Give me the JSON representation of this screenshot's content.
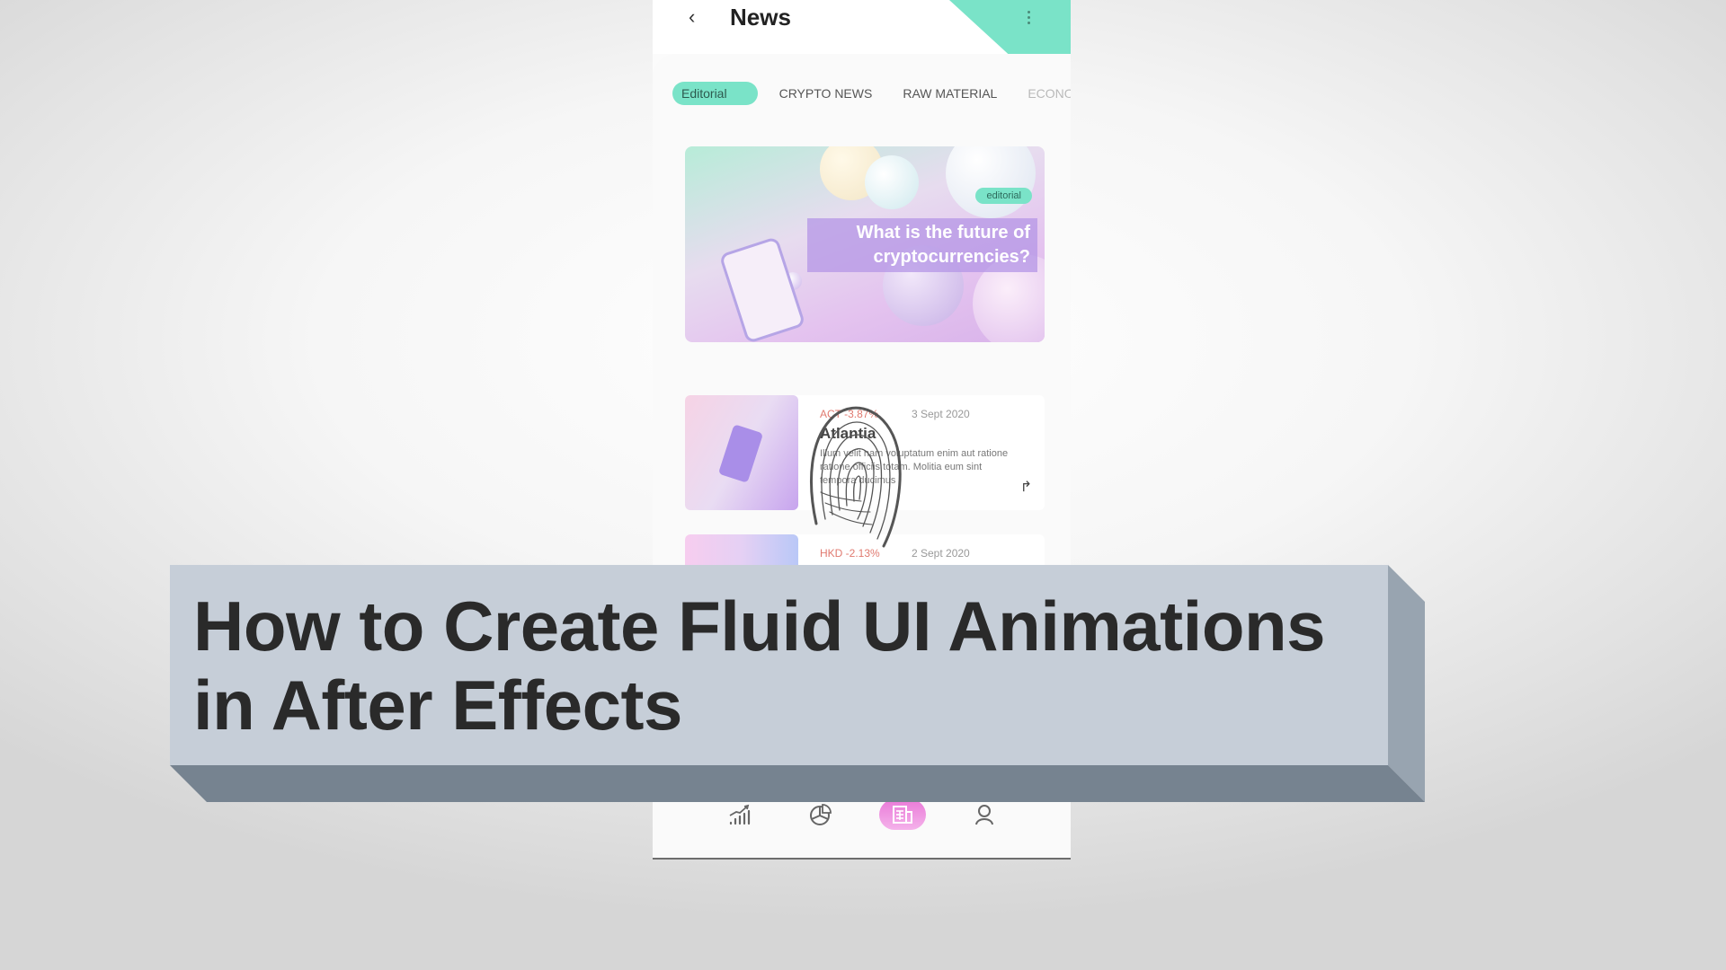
{
  "phone": {
    "header": {
      "back_icon": "chevron-left-icon",
      "back_glyph": "‹",
      "title": "News",
      "menu_icon": "more-vertical-icon"
    },
    "tabs": [
      {
        "label": "Editorial",
        "active": true
      },
      {
        "label": "CRYPTO NEWS",
        "active": false
      },
      {
        "label": "RAW MATERIAL",
        "active": false
      },
      {
        "label": "ECONOMIC",
        "active": false
      }
    ],
    "hero": {
      "badge": "editorial",
      "title": "What is the future of cryptocurrencies?"
    },
    "articles": [
      {
        "ticker": "ACT -3.87%",
        "date": "3 Sept 2020",
        "title": "Atlantia",
        "description": "Illum velit nam voluptatum enim aut ratione ratione officiis totam. Molitia eum sint tempora ducimus",
        "share_icon": "share-arrow-icon",
        "share_glyph": "↱"
      },
      {
        "ticker": "HKD -2.13%",
        "date": "2 Sept 2020"
      }
    ],
    "bottom_nav": [
      {
        "icon": "growth-chart-icon",
        "active": false
      },
      {
        "icon": "pie-chart-icon",
        "active": false
      },
      {
        "icon": "newspaper-icon",
        "active": true
      },
      {
        "icon": "user-icon",
        "active": false
      }
    ],
    "colors": {
      "accent_teal": "#7ae3c8",
      "accent_pink": "#ea7ad8",
      "negative": "#e07a70"
    }
  },
  "overlay": {
    "fingerprint_icon": "fingerprint-icon",
    "banner_line1": "How to Create Fluid UI Animations",
    "banner_line2": "in After Effects",
    "banner_color": "#c6ced8"
  }
}
